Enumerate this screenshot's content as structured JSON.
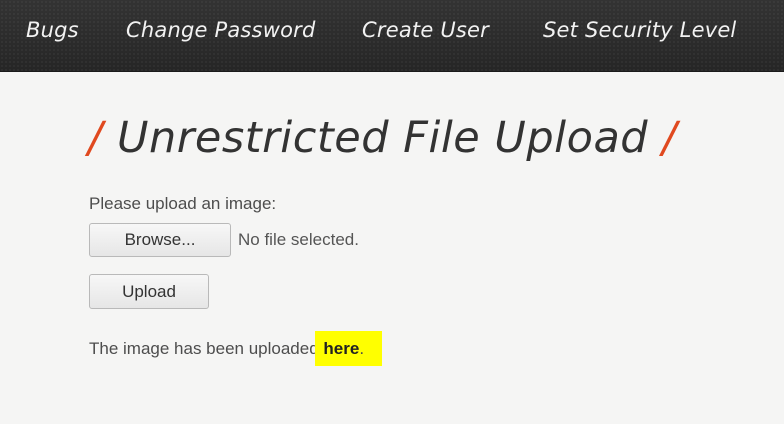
{
  "nav": {
    "items": [
      {
        "label": "Bugs"
      },
      {
        "label": "Change Password"
      },
      {
        "label": "Create User"
      },
      {
        "label": "Set Security Level"
      }
    ]
  },
  "page": {
    "title_slash_left": "/",
    "title": "Unrestricted File Upload",
    "title_slash_right": "/"
  },
  "form": {
    "label": "Please upload an image:",
    "browse_label": "Browse...",
    "file_status": "No file selected.",
    "upload_label": "Upload"
  },
  "result": {
    "text": "The image has been uploaded ",
    "link_text": "here",
    "suffix": "."
  },
  "colors": {
    "navbar": "#2c2c2c",
    "accent_slash": "#e0491f",
    "highlight": "#ffff00"
  }
}
